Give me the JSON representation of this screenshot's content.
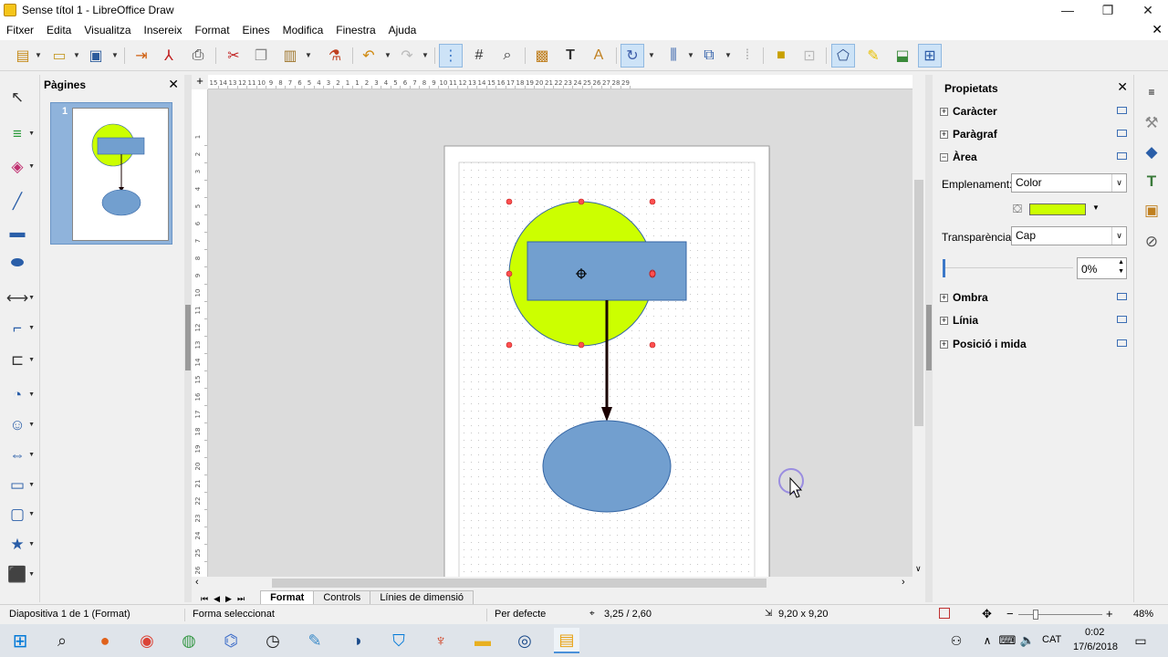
{
  "window": {
    "title": "Sense títol 1 - LibreOffice Draw",
    "minimize_glyph": "—",
    "maximize_glyph": "❐",
    "close_glyph": "✕"
  },
  "menu": [
    "Fitxer",
    "Edita",
    "Visualitza",
    "Insereix",
    "Format",
    "Eines",
    "Modifica",
    "Finestra",
    "Ajuda"
  ],
  "menu_close_glyph": "✕",
  "pages_pane": {
    "title": "Pàgines",
    "close_glyph": "✕",
    "page_number": "1"
  },
  "ruler": {
    "top_marks": [
      "15",
      "14",
      "13",
      "12",
      "11",
      "10",
      "9",
      "8",
      "7",
      "6",
      "5",
      "4",
      "3",
      "2",
      "1",
      "1",
      "2",
      "3",
      "4",
      "5",
      "6",
      "7",
      "8",
      "9",
      "10",
      "11",
      "12",
      "13",
      "14",
      "15",
      "16",
      "17",
      "18",
      "19",
      "20",
      "21",
      "22",
      "23",
      "24",
      "25",
      "26",
      "27",
      "28",
      "29"
    ],
    "left_marks": [
      "1",
      "2",
      "3",
      "4",
      "5",
      "6",
      "7",
      "8",
      "9",
      "10",
      "11",
      "12",
      "13",
      "14",
      "15",
      "16",
      "17",
      "18",
      "19",
      "20",
      "21",
      "22",
      "23",
      "24",
      "25",
      "26"
    ],
    "corner_glyph": "+"
  },
  "tabs": {
    "items": [
      "Format",
      "Controls",
      "Línies de dimensió"
    ],
    "active": "Format",
    "nav_glyphs": [
      "⏮",
      "◀",
      "▶",
      "⏭"
    ]
  },
  "sidebar": {
    "title": "Propietats",
    "close_glyph": "✕",
    "sections": {
      "character": "Caràcter",
      "paragraph": "Paràgraf",
      "area": "Àrea",
      "shadow": "Ombra",
      "line": "Línia",
      "position": "Posició i mida"
    },
    "expand_glyph": "+",
    "collapse_glyph": "−",
    "fill_label": "Emplenament:",
    "fill_value": "Color",
    "fill_color": "#ccff00",
    "transparency_label": "Transparència:",
    "transparency_value": "Cap",
    "transparency_percent": "0%",
    "dropdown_glyph": "∨"
  },
  "status": {
    "slide": "Diapositiva 1 de 1 (Format)",
    "selection": "Forma seleccionat",
    "style": "Per defecte",
    "position": "3,25 / 2,60",
    "size": "9,20 x 9,20",
    "zoom": "48%",
    "zoom_minus": "−",
    "zoom_plus": "+"
  },
  "taskbar": {
    "language": "CAT",
    "time": "0:02",
    "date": "17/6/2018"
  },
  "colors": {
    "circle_fill": "#ccff00",
    "shape_blue": "#729fcf",
    "shape_blue_stroke": "#3465a4",
    "handle": "#ff4040",
    "arrow": "#1a0000"
  }
}
